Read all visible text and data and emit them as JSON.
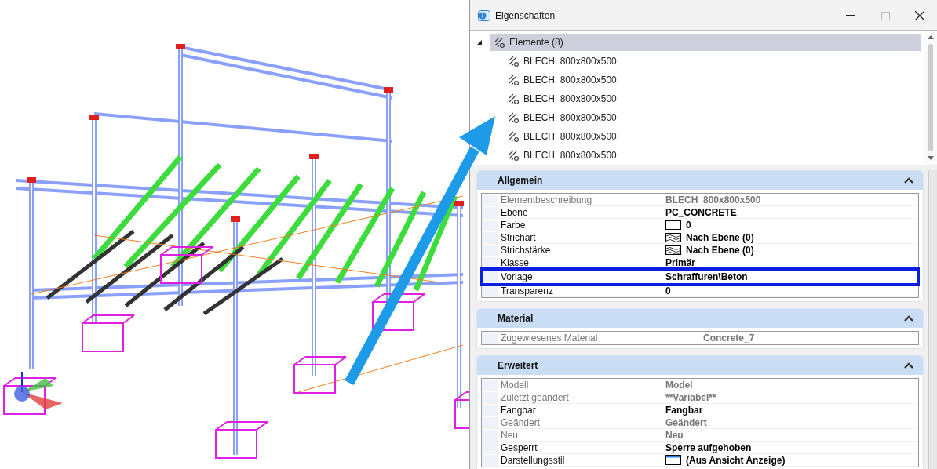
{
  "window": {
    "title": "Eigenschaften"
  },
  "tree": {
    "label": "Elemente (8)",
    "expanded": true,
    "selected": true,
    "children": [
      {
        "label": "BLECH  800x800x500",
        "selected": false
      },
      {
        "label": "BLECH  800x800x500",
        "selected": false
      },
      {
        "label": "BLECH  800x800x500",
        "selected": false
      },
      {
        "label": "BLECH  800x800x500",
        "selected": false
      },
      {
        "label": "BLECH  800x800x500",
        "selected": false
      },
      {
        "label": "BLECH  800x800x500",
        "selected": false
      }
    ]
  },
  "sections": [
    {
      "title": "Allgemein",
      "expanded": true,
      "rows": [
        {
          "label": "Elementbeschreibung",
          "value": "BLECH  800x800x500",
          "kind": "text",
          "disabled": true,
          "highlighted": false
        },
        {
          "label": "Ebene",
          "value": "PC_CONCRETE",
          "kind": "text",
          "disabled": false,
          "highlighted": false
        },
        {
          "label": "Farbe",
          "value": "0",
          "kind": "color",
          "disabled": false,
          "highlighted": false
        },
        {
          "label": "Strichart",
          "value": "Nach Ebene (0)",
          "kind": "hatch",
          "disabled": false,
          "highlighted": false
        },
        {
          "label": "Strichstärke",
          "value": "Nach Ebene (0)",
          "kind": "hatch",
          "disabled": false,
          "highlighted": false
        },
        {
          "label": "Klasse",
          "value": "Primär",
          "kind": "text",
          "disabled": false,
          "highlighted": false
        },
        {
          "label": "Vorlage",
          "value": "Schraffuren\\Beton",
          "kind": "text",
          "disabled": false,
          "highlighted": true
        },
        {
          "label": "Transparenz",
          "value": "0",
          "kind": "text",
          "disabled": false,
          "highlighted": false
        }
      ]
    },
    {
      "title": "Material",
      "expanded": true,
      "rows": [
        {
          "label": "Zugewiesenes Material",
          "value": "Concrete_7",
          "kind": "text",
          "disabled": true,
          "highlighted": false
        }
      ]
    },
    {
      "title": "Erweitert",
      "expanded": true,
      "rows": [
        {
          "label": "Modell",
          "value": "Model",
          "kind": "text",
          "disabled": true,
          "highlighted": false
        },
        {
          "label": "Zuletzt geändert",
          "value": "**Variabel**",
          "kind": "text",
          "disabled": true,
          "highlighted": false
        },
        {
          "label": "Fangbar",
          "value": "Fangbar",
          "kind": "text",
          "disabled": false,
          "highlighted": false
        },
        {
          "label": "Geändert",
          "value": "Geändert",
          "kind": "text",
          "disabled": true,
          "highlighted": false
        },
        {
          "label": "Neu",
          "value": "Neu",
          "kind": "text",
          "disabled": true,
          "highlighted": false
        },
        {
          "label": "Gesperrt",
          "value": "Sperre aufgehoben",
          "kind": "text",
          "disabled": false,
          "highlighted": false
        },
        {
          "label": "Darstellungsstil",
          "value": "(Aus Ansicht Anzeige)",
          "kind": "display",
          "disabled": false,
          "highlighted": false
        }
      ]
    }
  ]
}
